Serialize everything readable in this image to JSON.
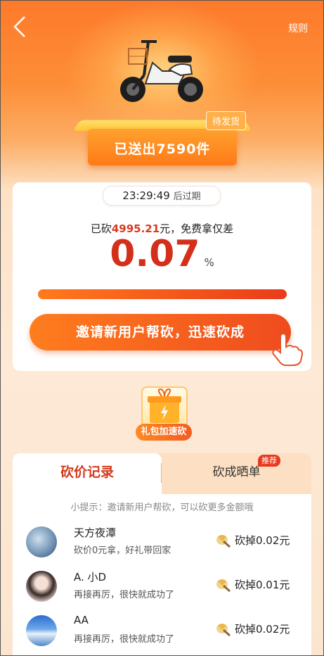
{
  "header": {
    "rule_label": "规则"
  },
  "hero": {
    "shipped_text": "已送出7590件",
    "pending_badge": "待发货"
  },
  "countdown": {
    "time": "23:29:49",
    "suffix": "后过期"
  },
  "progress": {
    "cut_prefix": "已砍",
    "cut_amount": "4995.21",
    "cut_suffix": "元，免费拿仅差",
    "remaining_percent": "0.07",
    "percent_sign": "%",
    "bar_fill_fraction": 0.9993
  },
  "invite_button": {
    "label": "邀请新用户帮砍，迅速砍成"
  },
  "gift": {
    "label": "礼包加速砍"
  },
  "tabs": [
    {
      "label": "砍价记录",
      "active": true
    },
    {
      "label": "砍成晒单",
      "active": false,
      "badge": "推荐"
    }
  ],
  "tip": "小提示：邀请新用户帮砍，可以砍更多金额哦",
  "records": [
    {
      "name": "天方夜潭",
      "message": "砍价0元拿，好礼带回家",
      "amount": "砍掉0.02元"
    },
    {
      "name": "A. 小D",
      "message": "再接再厉，很快就成功了",
      "amount": "砍掉0.01元"
    },
    {
      "name": "AA",
      "message": "再接再厉，很快就成功了",
      "amount": "砍掉0.02元"
    }
  ],
  "colors": {
    "brand_orange": "#fd7a2b",
    "accent_red": "#d32f1a"
  }
}
